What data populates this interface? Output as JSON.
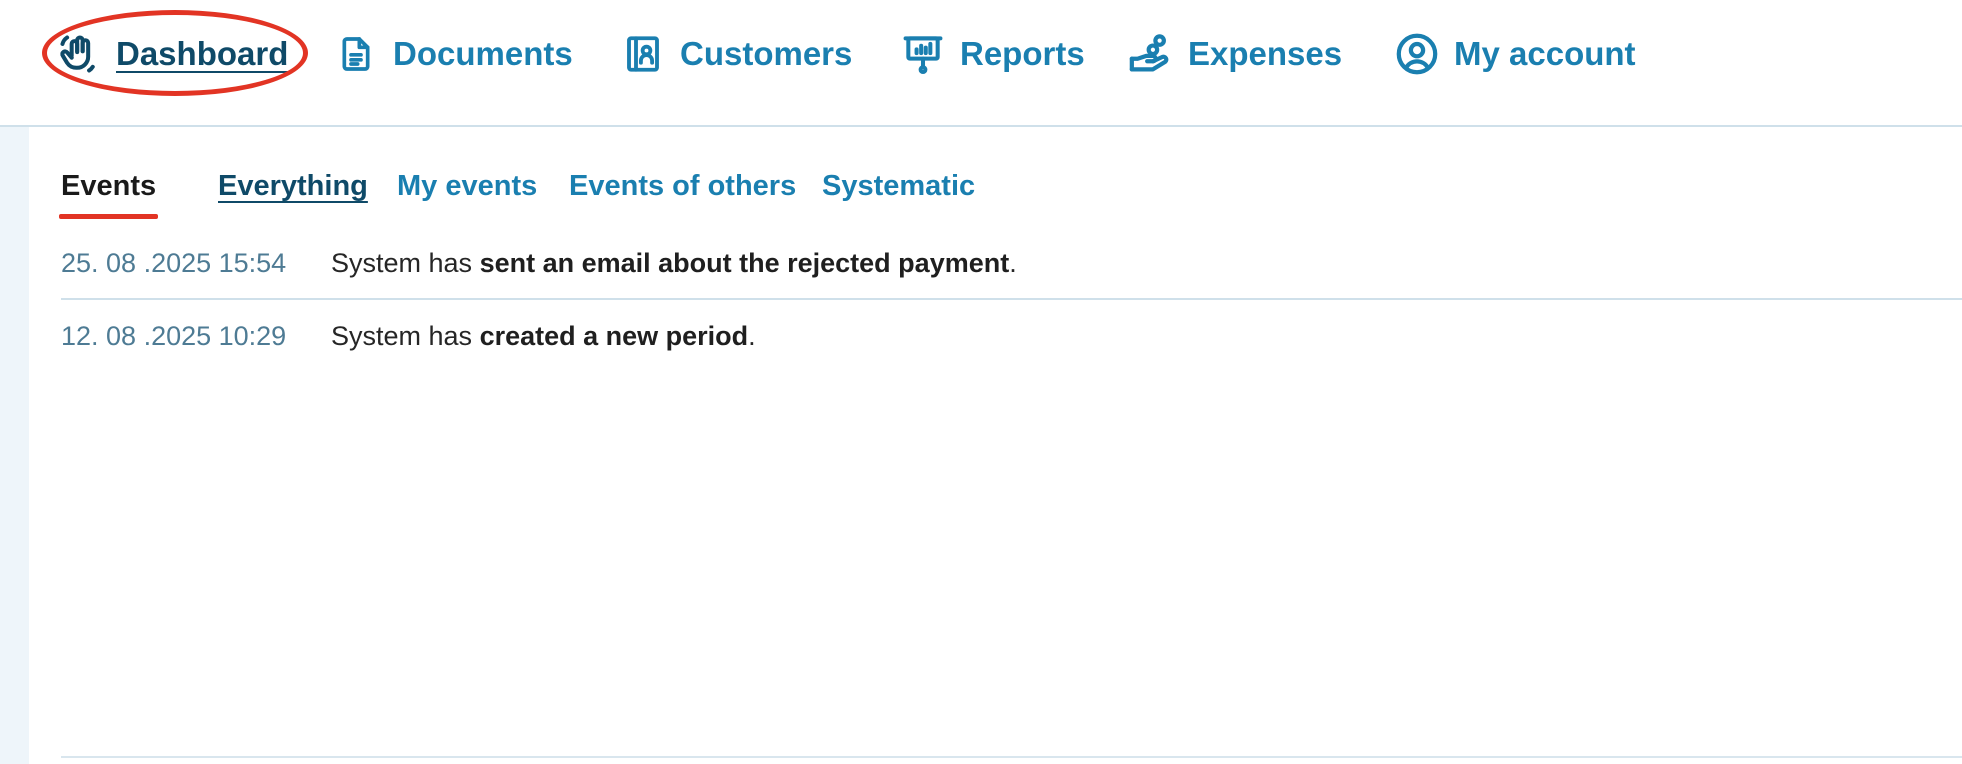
{
  "nav": {
    "items": [
      {
        "label": "Dashboard",
        "icon": "waving-hand-icon"
      },
      {
        "label": "Documents",
        "icon": "document-icon"
      },
      {
        "label": "Customers",
        "icon": "contact-book-icon"
      },
      {
        "label": "Reports",
        "icon": "presentation-board-icon"
      },
      {
        "label": "Expenses",
        "icon": "hand-coins-icon"
      },
      {
        "label": "My account",
        "icon": "user-circle-icon"
      }
    ],
    "active": "Dashboard"
  },
  "events": {
    "heading": "Events",
    "filters": [
      "Everything",
      "My events",
      "Events of others",
      "Systematic"
    ],
    "selected_filter": "Everything",
    "rows": [
      {
        "time": "25. 08 .2025 15:54",
        "prefix": "System has ",
        "action": "sent an email about the rejected payment",
        "suffix": "."
      },
      {
        "time": "12. 08 .2025 10:29",
        "prefix": "System has ",
        "action": "created a new period",
        "suffix": "."
      }
    ]
  },
  "colors": {
    "link": "#1a7fb0",
    "active_link": "#0f4a68",
    "highlight": "#e23424",
    "divider": "#cfe0ea"
  }
}
